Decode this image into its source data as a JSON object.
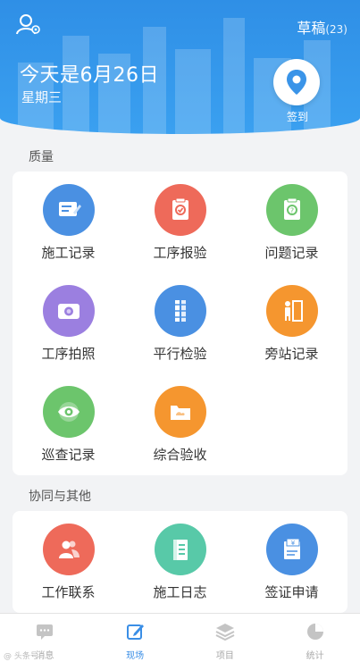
{
  "header": {
    "drafts_label": "草稿",
    "drafts_count": "(23)",
    "date": "今天是6月26日",
    "weekday": "星期三",
    "checkin_label": "签到"
  },
  "sections": {
    "quality_title": "质量",
    "collab_title": "协同与其他"
  },
  "quality_items": [
    {
      "label": "施工记录",
      "icon": "construction-record-icon",
      "color": "#4a90e2"
    },
    {
      "label": "工序报验",
      "icon": "process-inspection-icon",
      "color": "#ee6a5a"
    },
    {
      "label": "问题记录",
      "icon": "issue-record-icon",
      "color": "#6cc56c"
    },
    {
      "label": "工序拍照",
      "icon": "camera-icon",
      "color": "#9b7fe0"
    },
    {
      "label": "平行检验",
      "icon": "parallel-inspection-icon",
      "color": "#4a90e2"
    },
    {
      "label": "旁站记录",
      "icon": "onsite-record-icon",
      "color": "#f5962f"
    },
    {
      "label": "巡查记录",
      "icon": "patrol-eye-icon",
      "color": "#6cc56c"
    },
    {
      "label": "综合验收",
      "icon": "acceptance-icon",
      "color": "#f5962f"
    }
  ],
  "collab_items": [
    {
      "label": "工作联系",
      "icon": "contact-people-icon",
      "color": "#ee6a5a"
    },
    {
      "label": "施工日志",
      "icon": "construction-log-icon",
      "color": "#58c9a8"
    },
    {
      "label": "签证申请",
      "icon": "visa-application-icon",
      "color": "#4a90e2"
    }
  ],
  "tabs": [
    {
      "label": "消息",
      "icon": "message-icon",
      "active": false
    },
    {
      "label": "现场",
      "icon": "site-edit-icon",
      "active": true
    },
    {
      "label": "项目",
      "icon": "project-layers-icon",
      "active": false
    },
    {
      "label": "统计",
      "icon": "statistics-pie-icon",
      "active": false
    }
  ],
  "watermark": "@ 头条号"
}
